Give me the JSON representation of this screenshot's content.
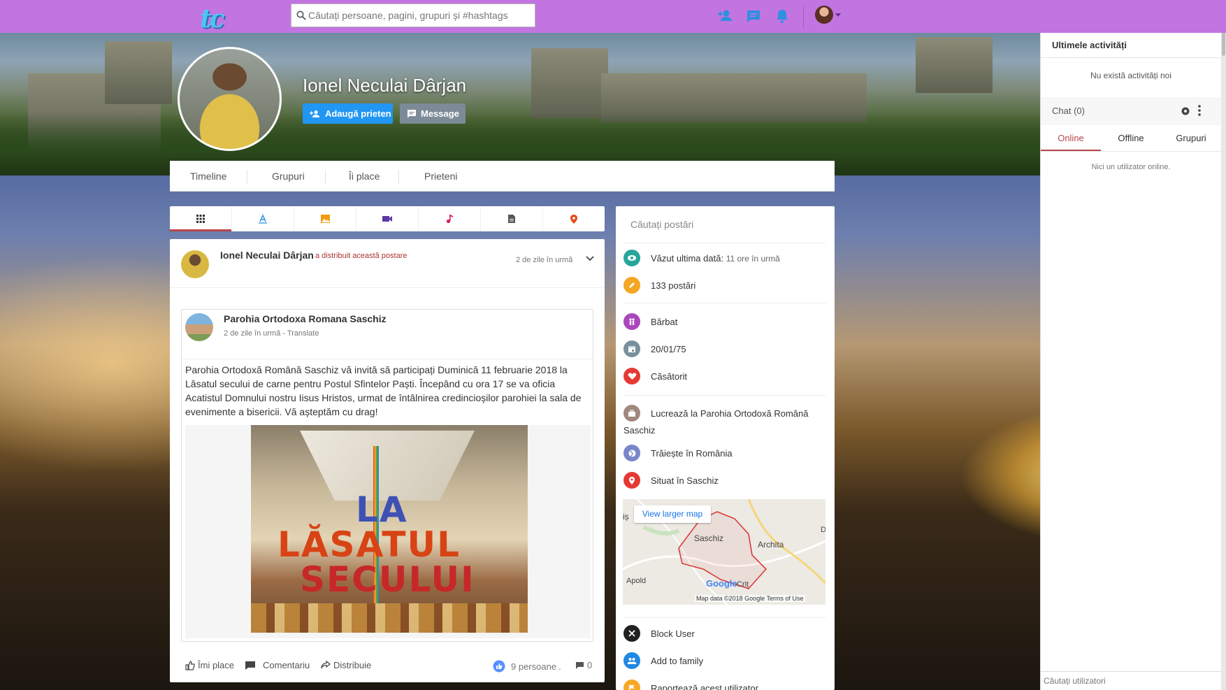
{
  "topbar": {
    "logo": "tc",
    "search_placeholder": "Căutați persoane, pagini, grupuri și #hashtags",
    "icons": [
      "add-user-icon",
      "chat-icon",
      "bell-icon"
    ],
    "color": "#c274e0"
  },
  "profile": {
    "name": "Ionel Neculai Dârjan",
    "add_friend": "Adaugă prieten",
    "message": "Message"
  },
  "nav": {
    "items": [
      "Timeline",
      "Grupuri",
      "Îi place",
      "Prieteni"
    ]
  },
  "filter_tabs": [
    "grid-icon",
    "text-icon",
    "image-icon",
    "video-icon",
    "music-icon",
    "file-icon",
    "location-icon"
  ],
  "post": {
    "author": "Ionel Neculai Dârjan",
    "shared_label": "a distribuit această postare",
    "time": "2 de zile în urmă",
    "shared": {
      "name": "Parohia Ortodoxa Romana Saschiz",
      "time": "2 de zile în urmă",
      "translate": "Translate",
      "text": "Parohia Ortodoxă Română Saschiz vă invită să participați Duminică 11 februarie 2018 la Lăsatul secului de carne pentru Postul Sfintelor Paști. Începând cu ora 17 se va oficia Acatistul Domnului nostru Iisus Hristos, urmat de întâlnirea credincioșilor parohiei la sala de evenimente a bisericii. Vă așteptăm cu drag!",
      "image_words": [
        "LA",
        "LĂSATUL",
        "SECULUI"
      ]
    },
    "actions": {
      "like": "Îmi place",
      "comment": "Comentariu",
      "share": "Distribuie",
      "likes_count": "9 persoane",
      "comments_count": "0"
    }
  },
  "info": {
    "search_placeholder": "Căutați postări",
    "last_seen_label": "Văzut ultima dată:",
    "last_seen_value": "11 ore în urmă",
    "posts": "133 postări",
    "gender": "Bărbat",
    "birthday": "20/01/75",
    "relationship": "Căsătorit",
    "work_line1": "Lucrează la Parohia Ortodoxă Română",
    "work_line2": "Saschiz",
    "lives_in": "Trăiește în România",
    "located_in": "Situat în Saschiz",
    "map": {
      "view_larger": "View larger map",
      "places": [
        "Saschiz",
        "Archita",
        "Apold",
        "Criț",
        "D",
        "iș"
      ],
      "footer": "Map data ©2018 Google  Terms of Use",
      "google": "Google"
    },
    "block_user": "Block User",
    "add_family": "Add to family",
    "report": "Raportează acest utilizator"
  },
  "right_panel": {
    "title": "Ultimele activități",
    "no_activity": "Nu există activități noi",
    "chat_title": "Chat (0)",
    "tabs": [
      "Online",
      "Offline",
      "Grupuri"
    ],
    "no_users": "Nici un utilizator online.",
    "search_placeholder": "Căutați utilizatori"
  }
}
